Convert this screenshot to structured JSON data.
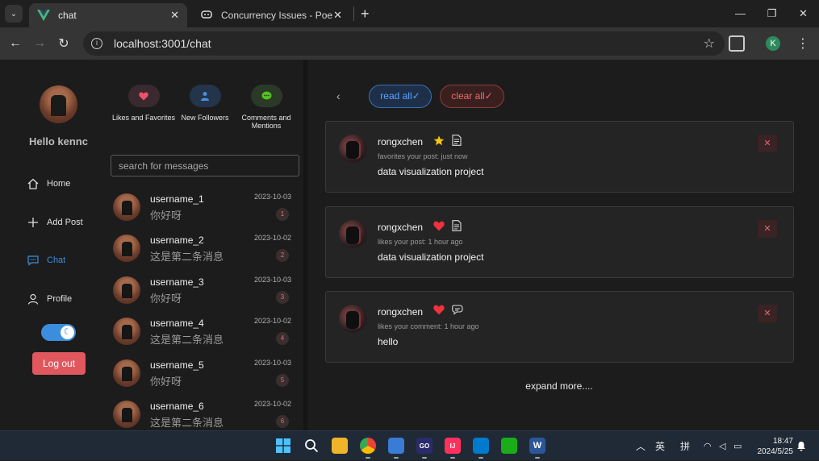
{
  "browser": {
    "tabs": [
      {
        "title": "chat",
        "active": true
      },
      {
        "title": "Concurrency Issues - Poe",
        "active": false
      }
    ],
    "url": "localhost:3001/chat",
    "profile_initial": "K"
  },
  "sidebar": {
    "greeting": "Hello kennc",
    "nav": [
      {
        "label": "Home",
        "icon": "home-icon"
      },
      {
        "label": "Add Post",
        "icon": "plus-icon"
      },
      {
        "label": "Chat",
        "icon": "chat-icon",
        "active": true
      },
      {
        "label": "Profile",
        "icon": "user-icon"
      }
    ],
    "logout_label": "Log out"
  },
  "categories": [
    {
      "label": "Likes and Favorites",
      "icon": "heart-icon",
      "color": "#f0506e"
    },
    {
      "label": "New Followers",
      "icon": "user-icon",
      "color": "#4a8fe6"
    },
    {
      "label": "Comments and Mentions",
      "icon": "comment-icon",
      "color": "#52c41a"
    }
  ],
  "search": {
    "placeholder": "search for messages"
  },
  "messages": [
    {
      "username": "username_1",
      "text": "你好呀",
      "date": "2023-10-03",
      "badge": "1"
    },
    {
      "username": "username_2",
      "text": "这是第二条消息",
      "date": "2023-10-02",
      "badge": "2"
    },
    {
      "username": "username_3",
      "text": "你好呀",
      "date": "2023-10-03",
      "badge": "3"
    },
    {
      "username": "username_4",
      "text": "这是第二条消息",
      "date": "2023-10-02",
      "badge": "4"
    },
    {
      "username": "username_5",
      "text": "你好呀",
      "date": "2023-10-03",
      "badge": "5"
    },
    {
      "username": "username_6",
      "text": "这是第二条消息",
      "date": "2023-10-02",
      "badge": "6"
    }
  ],
  "actions": {
    "read_all": "read all✓",
    "clear_all": "clear all✓"
  },
  "notifications": [
    {
      "name": "rongxchen",
      "action": "favorites your post: just now",
      "content": "data visualization project",
      "type_icon": "star-icon",
      "target_icon": "document-icon"
    },
    {
      "name": "rongxchen",
      "action": "likes your post: 1 hour ago",
      "content": "data visualization project",
      "type_icon": "heart-icon",
      "target_icon": "document-icon"
    },
    {
      "name": "rongxchen",
      "action": "likes your comment: 1 hour ago",
      "content": "hello",
      "type_icon": "heart-icon",
      "target_icon": "comment-icon"
    }
  ],
  "expand_label": "expand more....",
  "taskbar": {
    "ime_lang": "英",
    "ime_mode": "拼",
    "time": "18:47",
    "date": "2024/5/25"
  }
}
